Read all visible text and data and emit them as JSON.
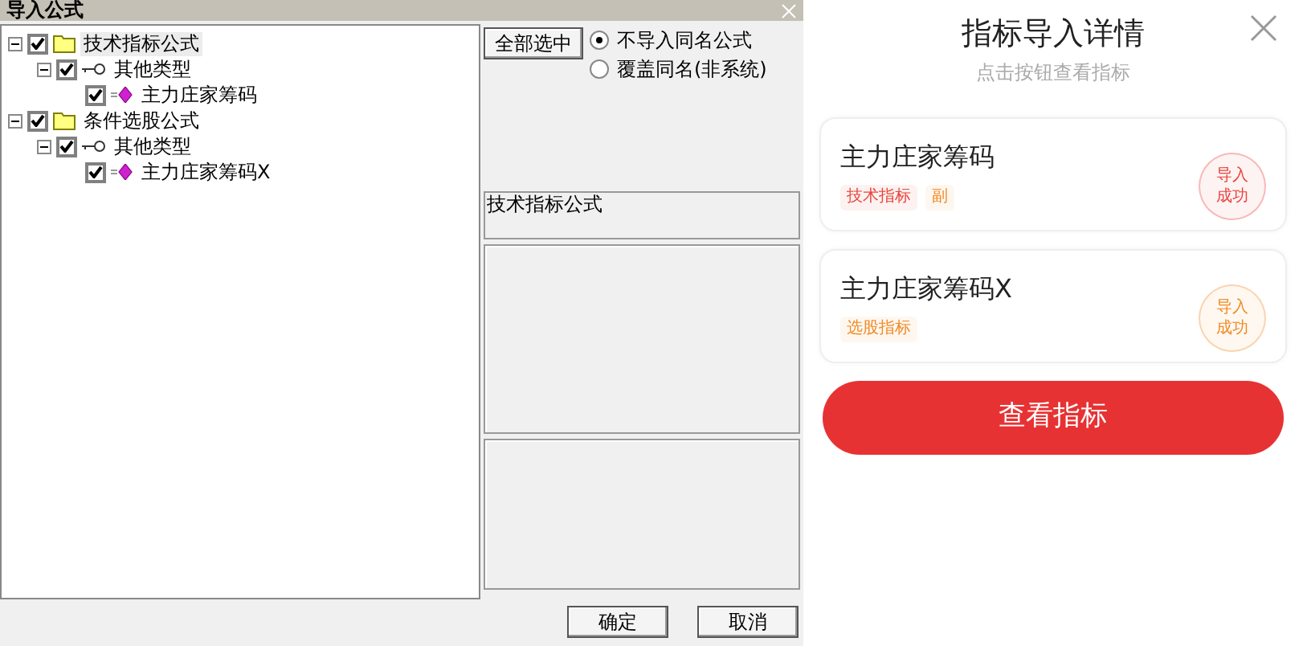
{
  "dialog": {
    "title": "导入公式",
    "tree": [
      {
        "label": "技术指标公式",
        "kind": "folder",
        "checked": true,
        "expanded": true,
        "selected": true,
        "children": [
          {
            "label": "其他类型",
            "kind": "key",
            "checked": true,
            "expanded": true,
            "selected": false,
            "children": [
              {
                "label": "主力庄家筹码",
                "kind": "formula",
                "checked": true,
                "selected": false
              }
            ]
          }
        ]
      },
      {
        "label": "条件选股公式",
        "kind": "folder",
        "checked": true,
        "expanded": true,
        "selected": false,
        "children": [
          {
            "label": "其他类型",
            "kind": "key",
            "checked": true,
            "expanded": true,
            "selected": false,
            "children": [
              {
                "label": "主力庄家筹码X",
                "kind": "formula",
                "checked": true,
                "selected": false
              }
            ]
          }
        ]
      }
    ],
    "select_all_button": "全部选中",
    "options": [
      {
        "label": "不导入同名公式",
        "selected": true
      },
      {
        "label": "覆盖同名(非系统)",
        "selected": false
      }
    ],
    "description_box": "技术指标公式",
    "buttons": [
      "确定",
      "取消"
    ]
  },
  "panel": {
    "title": "指标导入详情",
    "subtitle": "点击按钮查看指标",
    "items": [
      {
        "name": "主力庄家筹码",
        "tags": [
          {
            "label": "技术指标",
            "color": "#e8453c"
          },
          {
            "label": "副",
            "color": "#f08a24"
          }
        ],
        "badge": {
          "label": "导入成功",
          "color": "#e8453c"
        }
      },
      {
        "name": "主力庄家筹码X",
        "tags": [
          {
            "label": "选股指标",
            "color": "#f08a24"
          }
        ],
        "badge": {
          "label": "导入成功",
          "color": "#f08a24"
        }
      }
    ],
    "button": "查看指标"
  }
}
